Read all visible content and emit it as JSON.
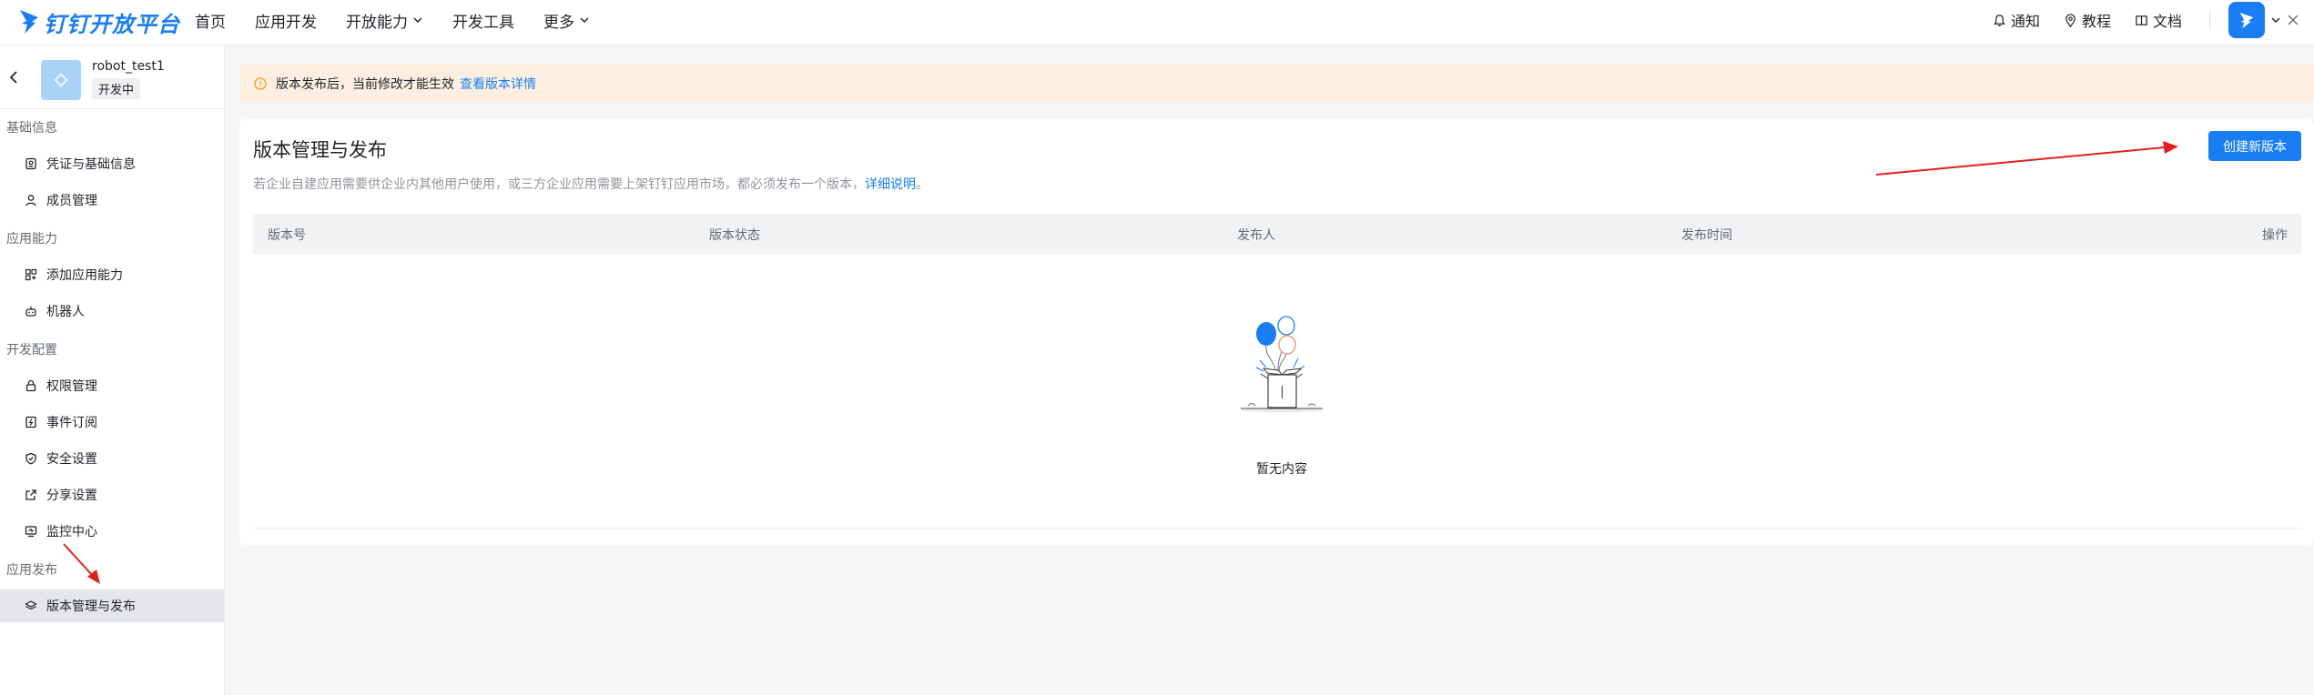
{
  "brand": {
    "name": "钉钉开放平台",
    "accent": "#1a7ef2"
  },
  "nav": {
    "items": [
      {
        "label": "首页",
        "icon": ""
      },
      {
        "label": "应用开发",
        "icon": ""
      },
      {
        "label": "开放能力",
        "icon": "chevron-down-icon"
      },
      {
        "label": "开发工具",
        "icon": ""
      },
      {
        "label": "更多",
        "icon": "chevron-down-icon"
      }
    ]
  },
  "topright": {
    "notify": "通知",
    "tutorial": "教程",
    "docs": "文档"
  },
  "app": {
    "name": "robot_test1",
    "status": "开发中"
  },
  "sidebar": {
    "groups": [
      {
        "label": "基础信息"
      },
      {
        "label": "应用能力"
      },
      {
        "label": "开发配置"
      },
      {
        "label": "应用发布"
      }
    ],
    "items": [
      {
        "label": "凭证与基础信息",
        "icon": "credential-icon"
      },
      {
        "label": "成员管理",
        "icon": "user-icon"
      },
      {
        "label": "添加应用能力",
        "icon": "grid-plus-icon"
      },
      {
        "label": "机器人",
        "icon": "robot-icon"
      },
      {
        "label": "权限管理",
        "icon": "lock-icon"
      },
      {
        "label": "事件订阅",
        "icon": "event-icon"
      },
      {
        "label": "安全设置",
        "icon": "shield-icon"
      },
      {
        "label": "分享设置",
        "icon": "share-icon"
      },
      {
        "label": "监控中心",
        "icon": "monitor-icon"
      },
      {
        "label": "版本管理与发布",
        "icon": "layers-icon",
        "active": true
      }
    ]
  },
  "alert": {
    "text": "版本发布后，当前修改才能生效",
    "link": "查看版本详情"
  },
  "main": {
    "title": "版本管理与发布",
    "desc": "若企业自建应用需要供企业内其他用户使用，或三方企业应用需要上架钉钉应用市场，都必须发布一个版本，",
    "desc_link": "详细说明",
    "desc_end": "。",
    "create_button": "创建新版本",
    "columns": [
      "版本号",
      "版本状态",
      "发布人",
      "发布时间",
      "操作"
    ],
    "rows": [],
    "empty_text": "暂无内容"
  }
}
